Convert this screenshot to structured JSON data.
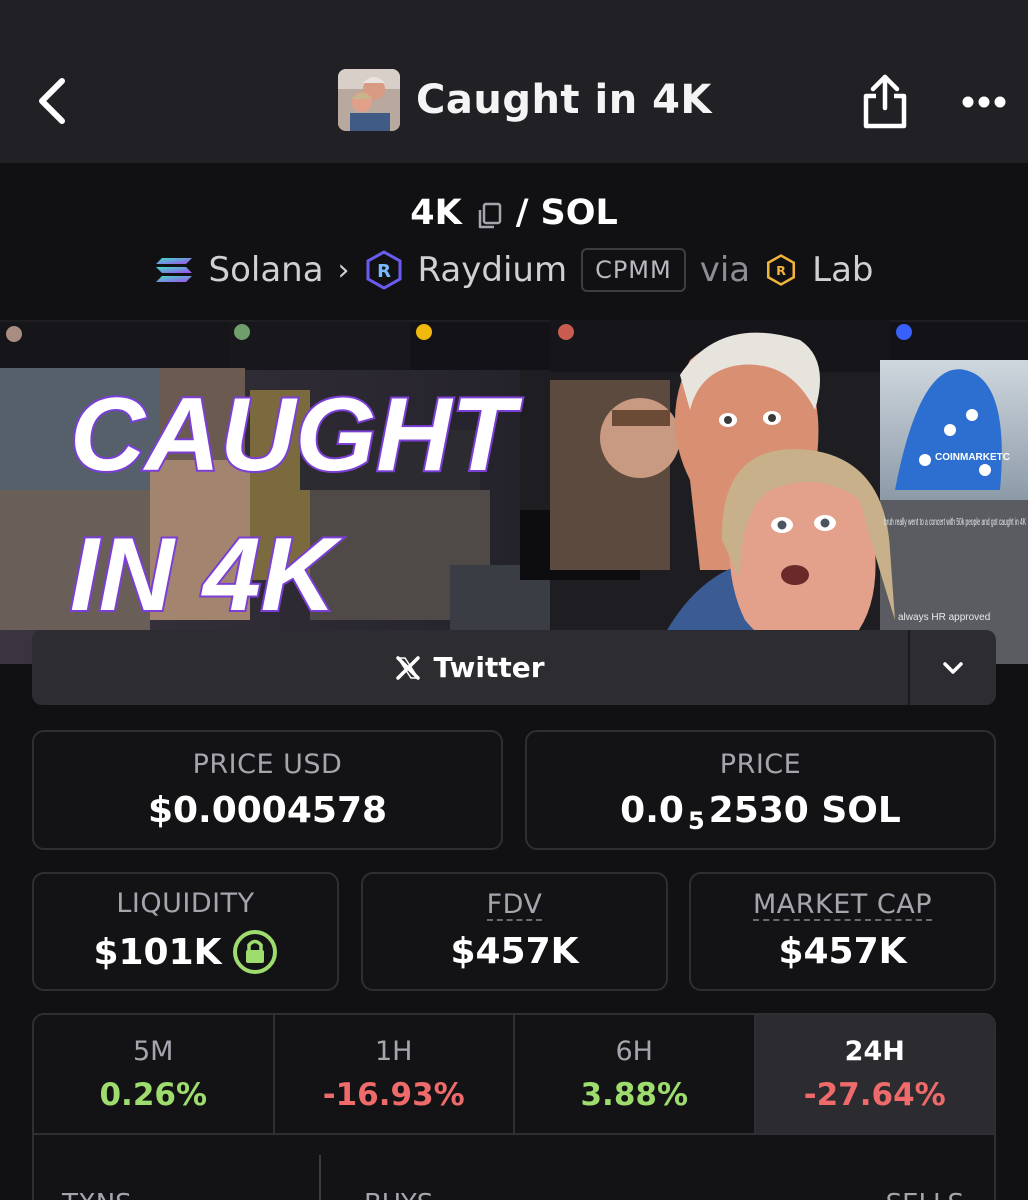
{
  "header": {
    "title": "Caught in 4K"
  },
  "pair": {
    "base": "4K",
    "separator": "/",
    "quote": "SOL"
  },
  "chain": {
    "network": "Solana",
    "dex": "Raydium",
    "pool_type": "CPMM",
    "via_label": "via",
    "launchpad": "Lab"
  },
  "banner": {
    "headline_line1": "CAUGHT",
    "headline_line2": "IN 4K",
    "brand_text": "COINMARKETC",
    "caption_text": "bruh really went to a concert with 50k people and got caught in 4K",
    "caption_text2": "always HR approved"
  },
  "twitter": {
    "label": "Twitter"
  },
  "stats": {
    "price_usd_label": "PRICE USD",
    "price_usd_value": "$0.0004578",
    "price_label": "PRICE",
    "price_value_prefix": "0.0",
    "price_value_zeros": "5",
    "price_value_suffix": "2530 SOL",
    "liquidity_label": "LIQUIDITY",
    "liquidity_value": "$101K",
    "fdv_label": "FDV",
    "fdv_value": "$457K",
    "market_cap_label": "MARKET CAP",
    "market_cap_value": "$457K"
  },
  "changes": [
    {
      "label": "5M",
      "value": "0.26%",
      "trend": "up"
    },
    {
      "label": "1H",
      "value": "-16.93%",
      "trend": "down"
    },
    {
      "label": "6H",
      "value": "3.88%",
      "trend": "up"
    },
    {
      "label": "24H",
      "value": "-27.64%",
      "trend": "down",
      "active": true
    }
  ],
  "txns": {
    "txns_label": "TXNS",
    "buys_label": "BUYS",
    "sells_label": "SELLS"
  },
  "colors": {
    "positive": "#9fdc6e",
    "negative": "#ef6b6b",
    "background": "#111114",
    "topbar": "#212125"
  },
  "icons": {
    "back": "chevron-left-icon",
    "share": "share-icon",
    "more": "more-horizontal-icon",
    "copy": "copy-icon",
    "solana": "solana-logo-icon",
    "raydium": "raydium-logo-icon",
    "lab": "lab-logo-icon",
    "twitter": "x-logo-icon",
    "dropdown": "chevron-down-icon",
    "lock": "lock-icon"
  }
}
